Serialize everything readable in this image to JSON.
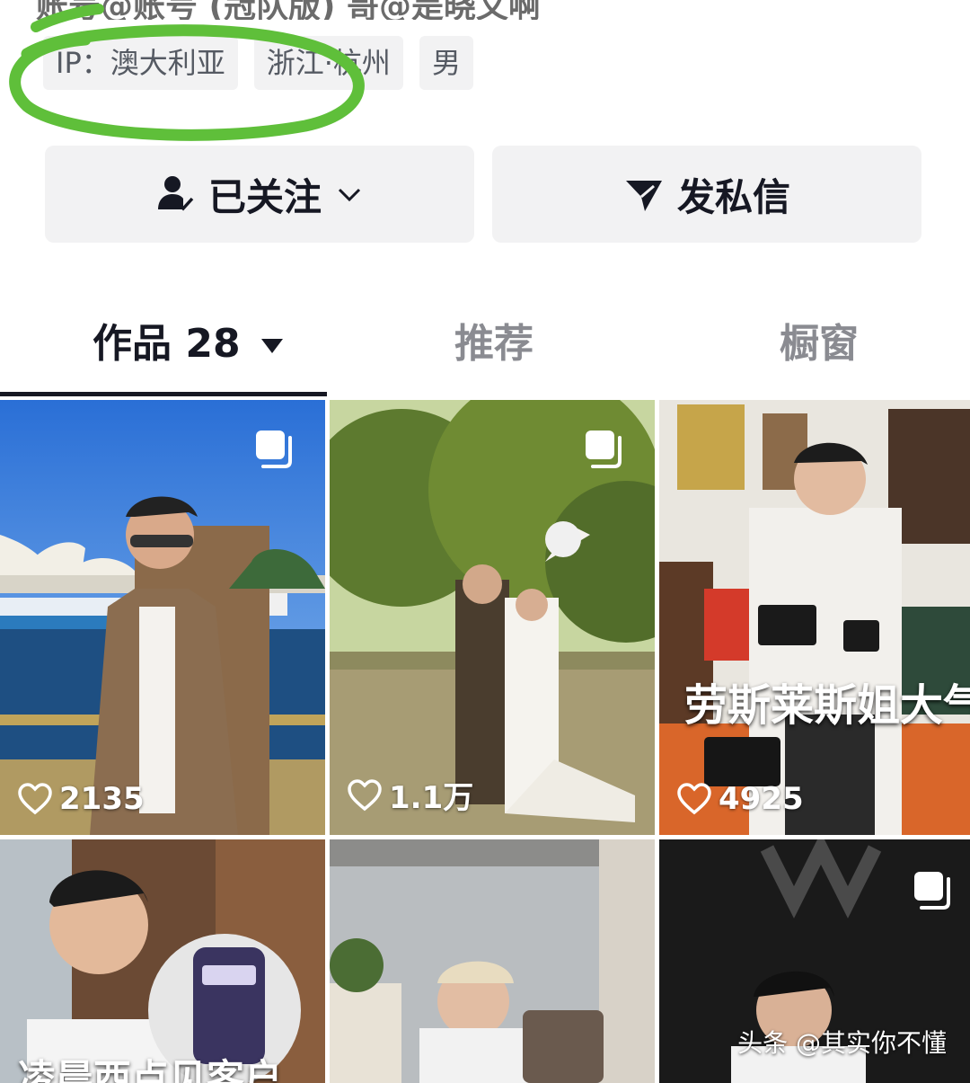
{
  "header": {
    "truncated_line": "账号@账号 (冠队版) 哥@是晓文啊"
  },
  "tags": [
    {
      "label": "IP：澳大利亚"
    },
    {
      "label": "浙江·杭州"
    },
    {
      "label": "男"
    }
  ],
  "annotation": {
    "color": "#5fbf3a"
  },
  "actions": {
    "follow_label": "已关注",
    "message_label": "发私信"
  },
  "tabs": {
    "works_label": "作品 28",
    "recommend_label": "推荐",
    "window_label": "橱窗"
  },
  "videos": [
    {
      "likes": "2135",
      "multi": true,
      "caption": ""
    },
    {
      "likes": "1.1万",
      "multi": true,
      "caption": ""
    },
    {
      "likes": "4925",
      "multi": false,
      "caption": "劳斯莱斯姐大气"
    },
    {
      "likes": "",
      "multi": false,
      "caption": "凌晨西点见客户"
    },
    {
      "likes": "",
      "multi": false,
      "caption": ""
    },
    {
      "likes": "",
      "multi": true,
      "caption": ""
    }
  ],
  "watermark": "头条 @其实你不懂"
}
